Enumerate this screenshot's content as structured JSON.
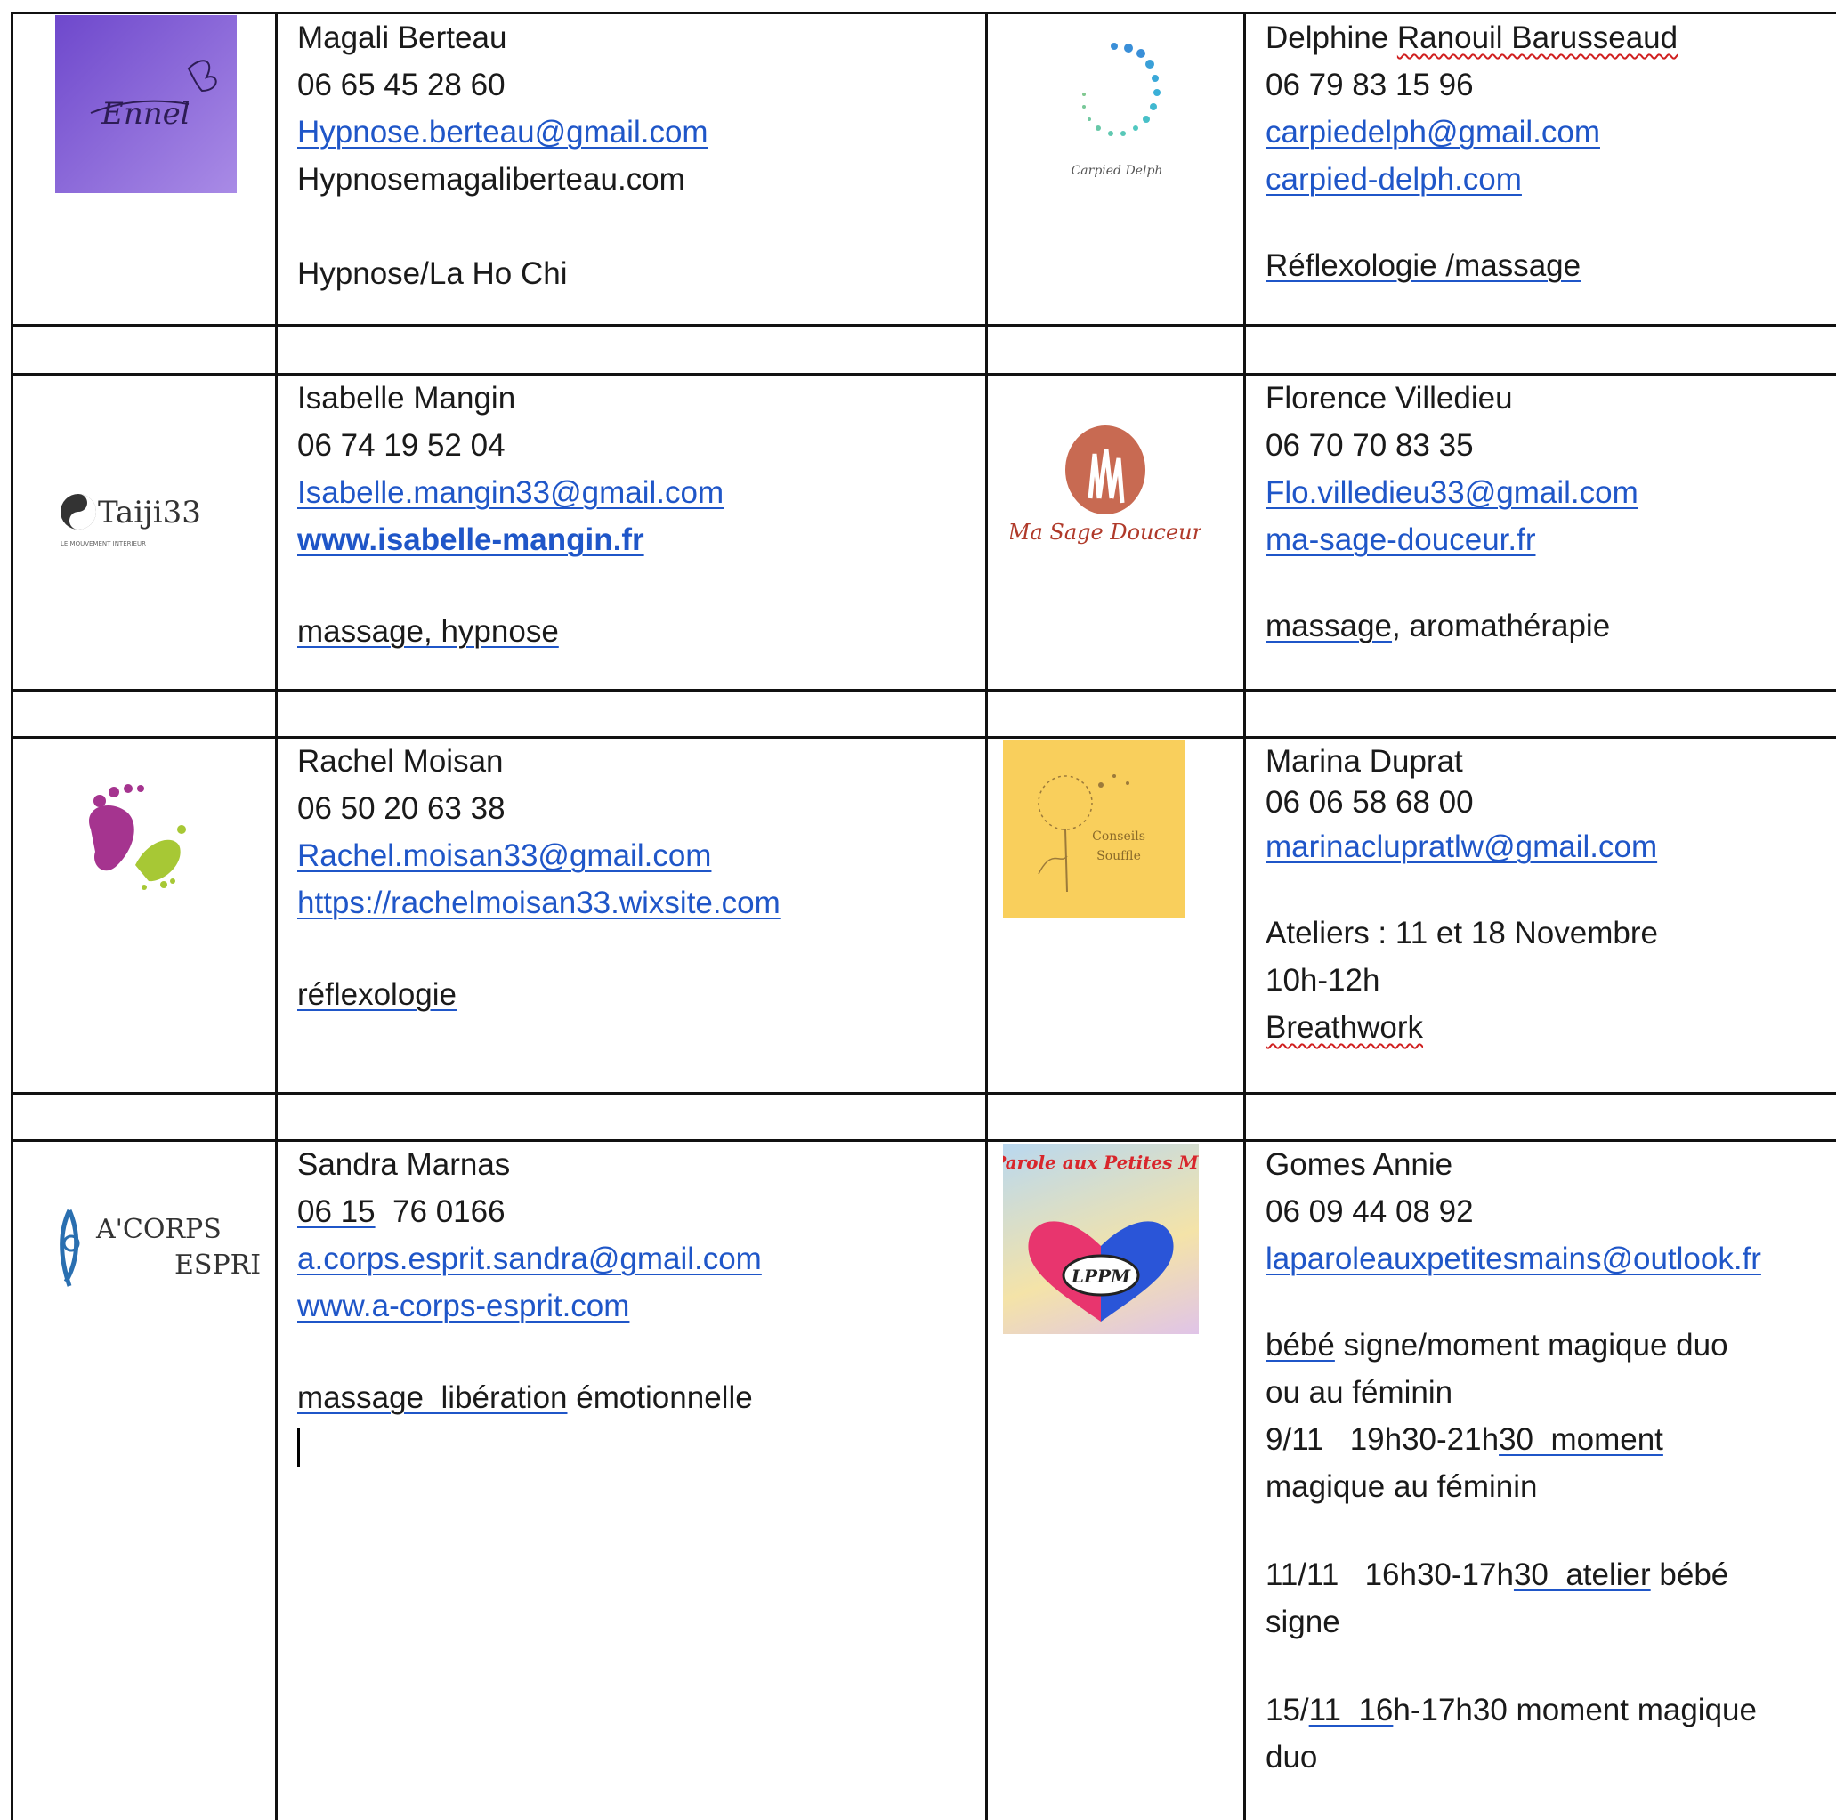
{
  "contacts": [
    {
      "logo": {
        "name": "ennet-logo",
        "text": "Ennel",
        "bg": "#8a62d8"
      },
      "name": "Magali Berteau",
      "phone": "06 65 45 28 60",
      "email": "Hypnose.berteau@gmail.com",
      "website": "Hypnosemagaliberteau.com",
      "specialty": "Hypnose/La Ho Chi"
    },
    {
      "logo": {
        "name": "carpied-delph-logo",
        "text": "Carpied Delph"
      },
      "name_first": "Delphine ",
      "name_rest": "Ranouil Barusseaud",
      "phone": "06 79 83 15 96",
      "email": "carpiedelph@gmail.com",
      "website": "carpied-delph.com",
      "specialty": "Réflexologie /massage"
    },
    {
      "logo": {
        "name": "taiji33-logo",
        "text": "Taiji33",
        "subtext": "LE MOUVEMENT INTERIEUR"
      },
      "name": "Isabelle Mangin",
      "phone": "06 74 19 52 04",
      "email": "Isabelle.mangin33@gmail.com",
      "website": "www.isabelle-mangin.fr",
      "specialty": "massage, hypnose"
    },
    {
      "logo": {
        "name": "ma-sage-douceur-logo",
        "text": "Ma Sage Douceur"
      },
      "name": "Florence Villedieu",
      "phone": "06 70 70 83 35",
      "email": "Flo.villedieu33@gmail.com",
      "website": "ma-sage-douceur.fr",
      "specialty_a": "massage",
      "specialty_b": ", aromathérapie"
    },
    {
      "logo": {
        "name": "footprint-logo"
      },
      "name": "Rachel Moisan",
      "phone": "06 50 20 63 38",
      "email": "Rachel.moisan33@gmail.com",
      "website": "https://rachelmoisan33.wixsite.com",
      "specialty": "réflexologie"
    },
    {
      "logo": {
        "name": "conseils-souffle-logo",
        "text_line1": "Conseils",
        "text_line2": "Souffle",
        "bg": "#f9cf5c"
      },
      "name": "Marina Duprat",
      "phone": "06 06 58 68 00",
      "email": "marinaclupratlw@gmail.com",
      "workshops": "Ateliers : 11 et 18 Novembre",
      "hours": "10h-12h",
      "specialty": "Breathwork"
    },
    {
      "logo": {
        "name": "a-corps-esprit-logo",
        "text_line1": "A'CORPS",
        "text_line2": "ESPRI"
      },
      "name": "Sandra Marnas",
      "phone_a": "06  15",
      "phone_b": "  76 0166",
      "email": "a.corps.esprit.sandra@gmail.com",
      "website": "www.a-corps-esprit.com",
      "specialty_a": "massage  libération",
      "specialty_b": " émotionnelle"
    },
    {
      "logo": {
        "name": "lppm-logo",
        "title": "La Parole aux Petites Mains",
        "badge": "LPPM"
      },
      "name": "Gomes Annie",
      "phone": "06 09 44 08 92",
      "email": "laparoleauxpetitesmains@outlook.fr",
      "desc_a": "bébé",
      "desc_b": " signe/moment magique duo",
      "desc_line2": "ou au féminin",
      "event1_a": "9/11   19h30-21h",
      "event1_b": "30  moment",
      "event1_line2": "magique au féminin",
      "event2_a": "11/11   16h30-17h",
      "event2_b": "30  atelier",
      "event2_c": " bébé",
      "event2_line2": "signe",
      "event3_a": "15/",
      "event3_b": "11  16",
      "event3_c": "h-17h30 moment magique",
      "event3_line2": "duo"
    }
  ],
  "colors": {
    "link": "#1f56c8",
    "grid": "#111111",
    "text": "#1a1a1a"
  }
}
